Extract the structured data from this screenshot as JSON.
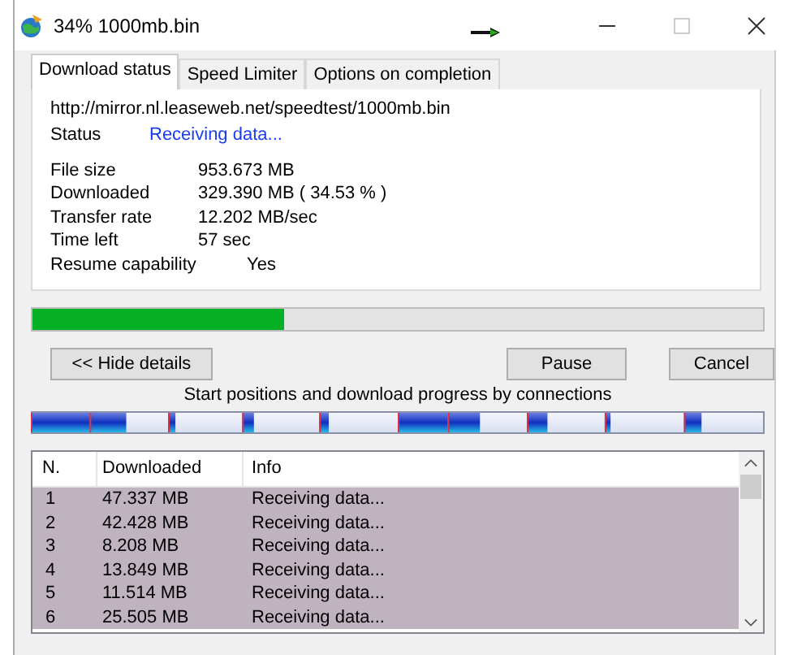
{
  "window": {
    "title": "34% 1000mb.bin"
  },
  "tabs": [
    {
      "label": "Download status",
      "selected": true
    },
    {
      "label": "Speed Limiter",
      "selected": false
    },
    {
      "label": "Options on completion",
      "selected": false
    }
  ],
  "url": "http://mirror.nl.leaseweb.net/speedtest/1000mb.bin",
  "status": {
    "label": "Status",
    "value": "Receiving data..."
  },
  "details": [
    {
      "label": "File size",
      "value": "953.673  MB"
    },
    {
      "label": "Downloaded",
      "value": "329.390  MB  ( 34.53 % )"
    },
    {
      "label": "Transfer rate",
      "value": "12.202  MB/sec"
    },
    {
      "label": "Time left",
      "value": "57 sec"
    },
    {
      "label": "Resume capability",
      "value": "Yes"
    }
  ],
  "progress": {
    "level": 0.3453
  },
  "buttons": {
    "hide_details": "<< Hide details",
    "pause": "Pause",
    "cancel": "Cancel"
  },
  "connections_caption": "Start positions and download progress by connections",
  "table": {
    "columns": [
      "N.",
      "Downloaded",
      "Info"
    ],
    "rows": [
      {
        "n": "1",
        "downloaded": "47.337 MB",
        "info": "Receiving data...",
        "selected": true
      },
      {
        "n": "2",
        "downloaded": "42.428 MB",
        "info": "Receiving data...",
        "selected": true
      },
      {
        "n": "3",
        "downloaded": "8.208 MB",
        "info": "Receiving data...",
        "selected": true
      },
      {
        "n": "4",
        "downloaded": "13.849 MB",
        "info": "Receiving data...",
        "selected": true
      },
      {
        "n": "5",
        "downloaded": "11.514 MB",
        "info": "Receiving data...",
        "selected": true
      },
      {
        "n": "6",
        "downloaded": "25.505 MB",
        "info": "Receiving data...",
        "selected": true
      }
    ]
  }
}
